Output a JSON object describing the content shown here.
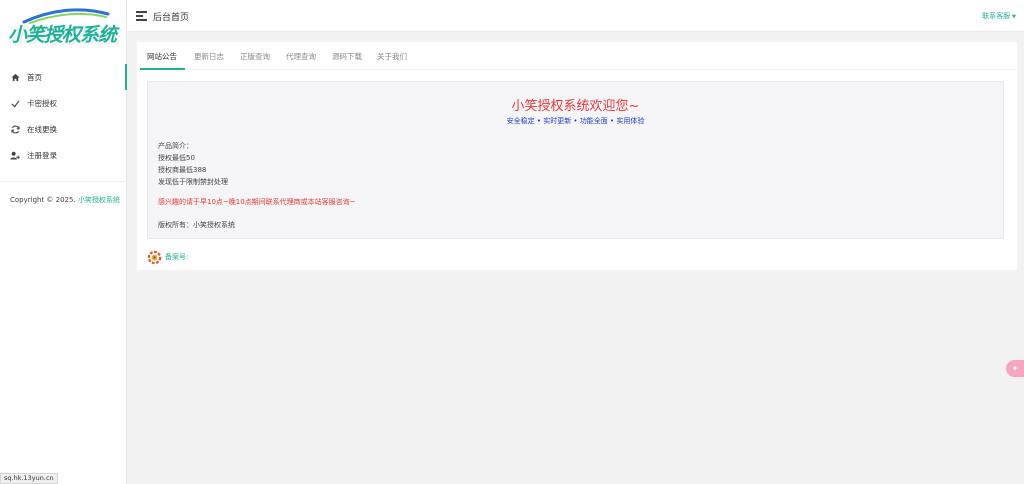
{
  "sidebar": {
    "logo_text": "小笑授权系统",
    "items": [
      {
        "label": "首页",
        "icon": "home-icon",
        "active": true
      },
      {
        "label": "卡密授权",
        "icon": "check-icon",
        "active": false
      },
      {
        "label": "在线更换",
        "icon": "refresh-icon",
        "active": false
      },
      {
        "label": "注册登录",
        "icon": "user-add-icon",
        "active": false
      }
    ],
    "copyright_prefix": "Copyright © 2025.",
    "copyright_brand": "小笑授权系统"
  },
  "topbar": {
    "page_title": "后台首页",
    "contact_label": "联系客服"
  },
  "tabs": [
    {
      "label": "网站公告",
      "active": true
    },
    {
      "label": "更新日志",
      "active": false
    },
    {
      "label": "正版查询",
      "active": false
    },
    {
      "label": "代理查询",
      "active": false
    },
    {
      "label": "源码下载",
      "active": false
    },
    {
      "label": "关于我们",
      "active": false
    }
  ],
  "notice": {
    "title": "小笑授权系统欢迎您~",
    "subtitle": "安全稳定 • 实时更新 • 功能全面 • 实用体验",
    "lines": [
      "产品简介：",
      "授权最低50",
      "授权商最低388",
      "发现低于限制禁封处理"
    ],
    "warning": "感兴趣的请于早10点~晚10点期间联系代理商或本站客服咨询~",
    "owner": "版权所有：小笑授权系统"
  },
  "beian": {
    "label": "备案号:"
  },
  "statusbar": {
    "url": "sq.hk.13yun.cn"
  },
  "colors": {
    "accent": "#1ab394",
    "title_red": "#e53935",
    "subtitle_blue": "#1a3bd1"
  }
}
